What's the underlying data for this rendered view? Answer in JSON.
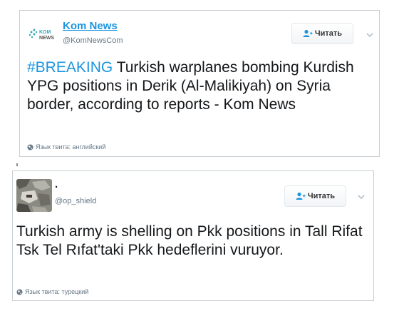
{
  "tweets": [
    {
      "display_name": "Kom News",
      "handle": "@KomNewsCom",
      "avatar_text": "KOM NEWS",
      "follow_label": "Читать",
      "hashtag": "#BREAKING",
      "text": "Turkish warplanes bombing Kurdish YPG positions in Derik (Al-Malikiyah) on Syria border, according to reports - Kom News",
      "language_label": "Язык твита: английский"
    },
    {
      "display_name": ".",
      "handle": "@op_shield",
      "follow_label": "Читать",
      "text_line1": "Turkish army is shelling on Pkk positions in Tall Rifat",
      "text_line2": "Tsk Tel Rıfat'taki Pkk hedeflerini vuruyor.",
      "language_label": "Язык твита: турецкий"
    }
  ],
  "colors": {
    "link": "#1b95e0",
    "text": "#14171a",
    "muted": "#657786",
    "border": "#c8cdd2"
  }
}
